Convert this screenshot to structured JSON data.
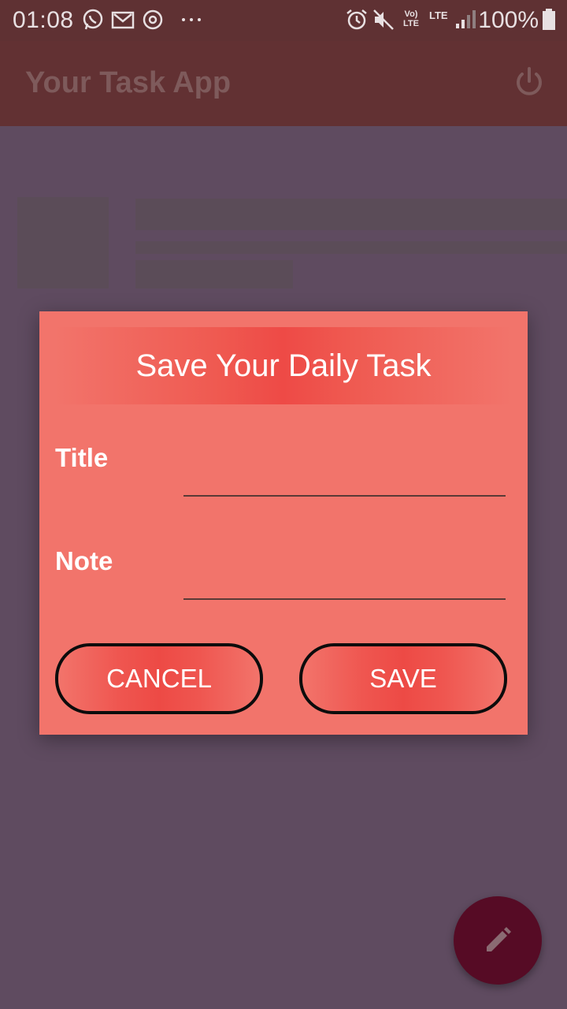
{
  "status_bar": {
    "time": "01:08",
    "battery": "100%",
    "icons": [
      "whatsapp-icon",
      "gmail-icon",
      "sync-icon",
      "more-dots-icon",
      "alarm-icon",
      "mute-icon",
      "volte-icon",
      "lte-icon",
      "signal-icon",
      "battery-icon"
    ],
    "volte_label": "Vo) LTE",
    "lte_label": "LTE"
  },
  "app_bar": {
    "title": "Your Task App",
    "action_icon": "power-icon"
  },
  "dialog": {
    "title": "Save Your Daily Task",
    "title_field_label": "Title",
    "title_field_value": "",
    "note_field_label": "Note",
    "note_field_value": "",
    "cancel_label": "CANCEL",
    "save_label": "SAVE"
  },
  "fab": {
    "icon": "edit-pencil-icon"
  },
  "colors": {
    "dialog_bg": "#f2746b",
    "accent_red": "#ee4a46",
    "app_bar": "#623133",
    "fab": "#560b25",
    "scrim": "#5f4b60"
  }
}
